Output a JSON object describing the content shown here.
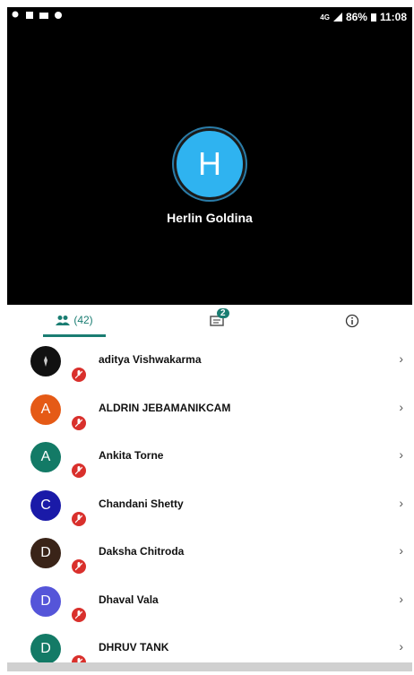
{
  "status": {
    "network": "4G",
    "battery": "86%",
    "time": "11:08"
  },
  "host": {
    "initial": "H",
    "name": "Herlin Goldina",
    "color": "#2fb3f0"
  },
  "tabs": {
    "participants_count": "(42)",
    "chat_badge": "2"
  },
  "participants": [
    {
      "initial": "",
      "name": "aditya Vishwakarma",
      "color": "#111111"
    },
    {
      "initial": "A",
      "name": "ALDRIN JEBAMANIKCAM",
      "color": "#e55a16"
    },
    {
      "initial": "A",
      "name": "Ankita Torne",
      "color": "#137a66"
    },
    {
      "initial": "C",
      "name": "Chandani Shetty",
      "color": "#1a1aa8"
    },
    {
      "initial": "D",
      "name": "Daksha Chitroda",
      "color": "#3a2418"
    },
    {
      "initial": "D",
      "name": "Dhaval Vala",
      "color": "#5555d9"
    },
    {
      "initial": "D",
      "name": "DHRUV TANK",
      "color": "#137a66"
    }
  ],
  "icons": {
    "chevron": "›"
  }
}
